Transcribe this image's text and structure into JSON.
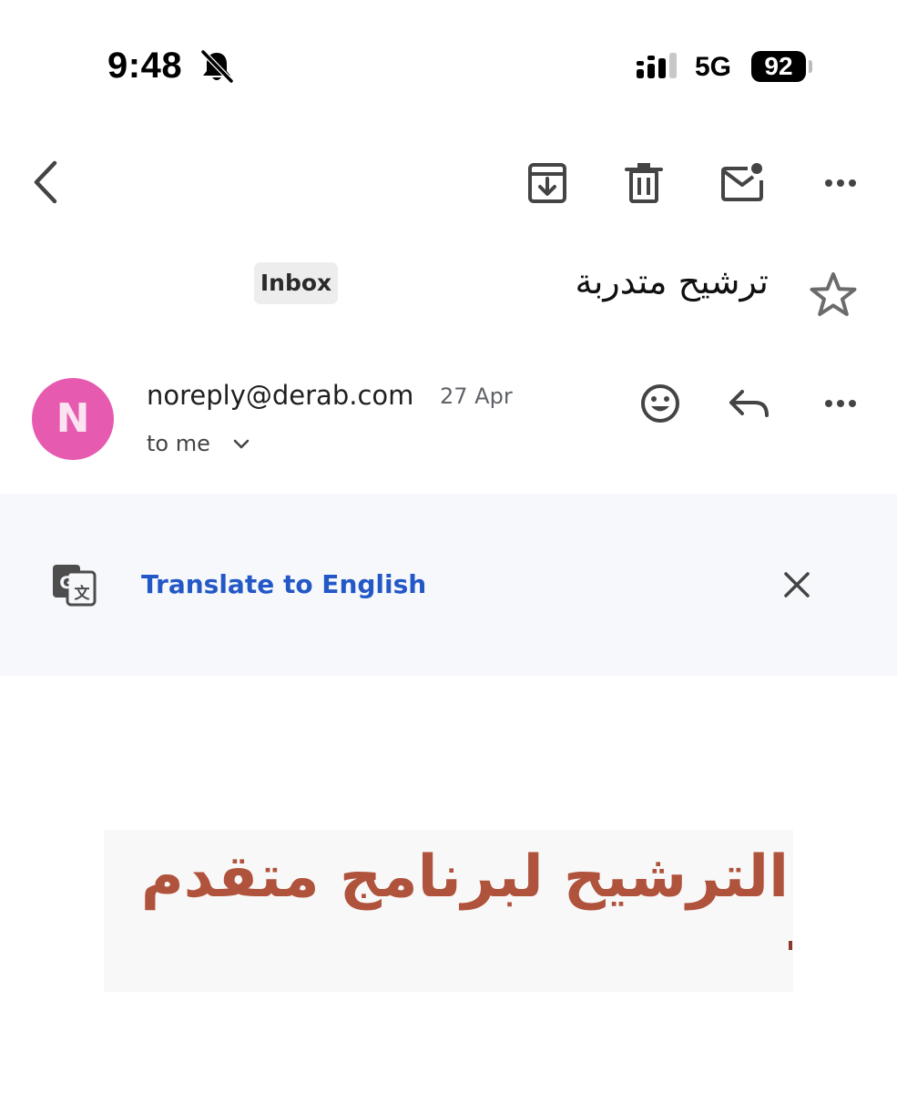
{
  "status_bar": {
    "time": "9:48",
    "network": "5G",
    "battery": "92"
  },
  "toolbar": {
    "icons": [
      "back-icon",
      "archive-icon",
      "delete-icon",
      "mark-unread-icon",
      "more-icon"
    ]
  },
  "email": {
    "subject": "ترشيح متدربة",
    "label": "Inbox",
    "sender": {
      "avatar_initial": "N",
      "avatar_color": "#e65bb0",
      "email": "noreply@derab.com",
      "date": "27 Apr",
      "recipient": "to me"
    },
    "translate": {
      "link_text": "Translate to English"
    },
    "body": {
      "heading": "الترشيح لبرنامج متقدم",
      "heading_color": "#b0533c"
    }
  }
}
